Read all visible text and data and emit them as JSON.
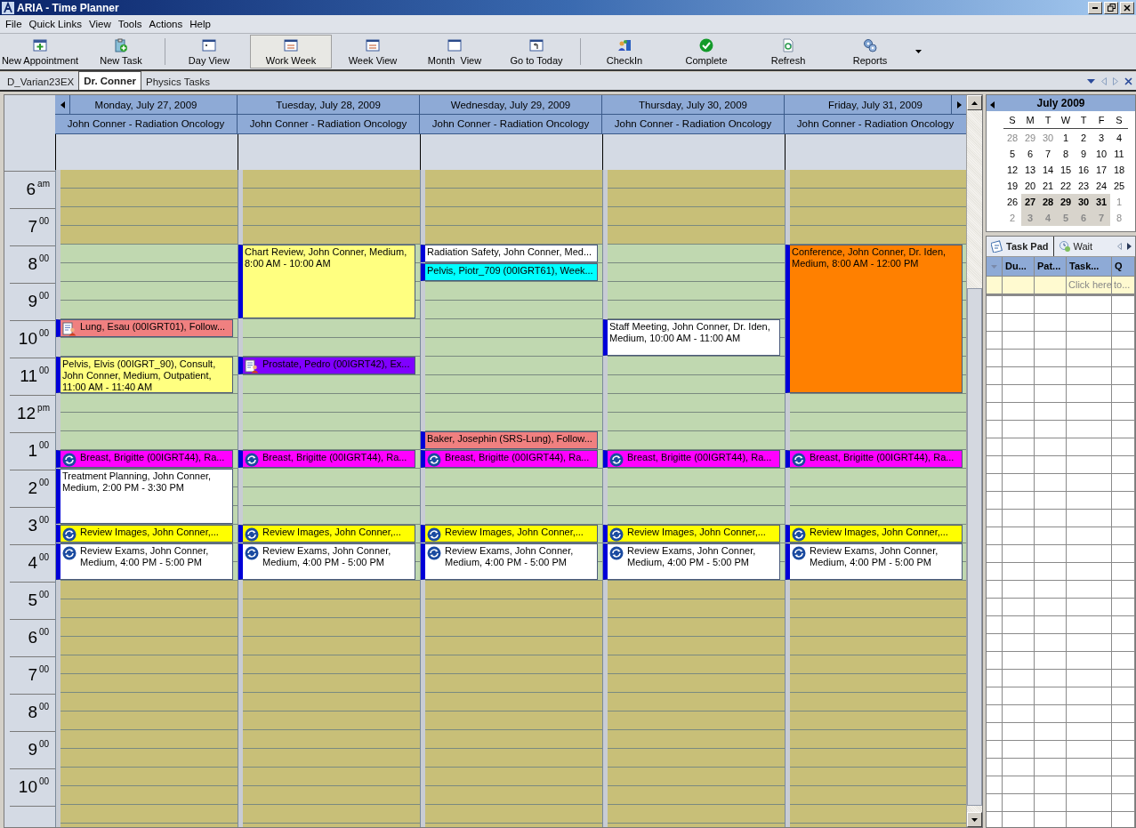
{
  "window": {
    "title": "ARIA - Time Planner"
  },
  "menu": [
    "File",
    "Quick Links",
    "View",
    "Tools",
    "Actions",
    "Help"
  ],
  "toolbar": {
    "groups": [
      [
        {
          "label": "New Appointment",
          "kind": "new-appointment",
          "selected": false
        },
        {
          "label": "New Task",
          "kind": "new-task",
          "selected": false
        }
      ],
      [
        {
          "label": "Day View",
          "kind": "day",
          "selected": false
        },
        {
          "label": "Work Week",
          "kind": "work-week",
          "selected": true
        },
        {
          "label": "Week View",
          "kind": "week",
          "selected": false
        },
        {
          "label": "Month  View",
          "kind": "month",
          "selected": false
        },
        {
          "label": "Go to Today",
          "kind": "today",
          "selected": false
        }
      ],
      [
        {
          "label": "CheckIn",
          "kind": "checkin",
          "selected": false
        },
        {
          "label": "Complete",
          "kind": "complete",
          "selected": false
        },
        {
          "label": "Refresh",
          "kind": "refresh",
          "selected": false
        },
        {
          "label": "Reports",
          "kind": "reports",
          "selected": false
        }
      ]
    ]
  },
  "tabs": [
    {
      "label": "D_Varian23EX",
      "selected": false
    },
    {
      "label": "Dr. Conner",
      "selected": true
    },
    {
      "label": "Physics Tasks",
      "selected": false
    }
  ],
  "schedule": {
    "hours": [
      {
        "hour": "6",
        "suffix": "am",
        "working": false
      },
      {
        "hour": "7",
        "suffix": "00",
        "working": false
      },
      {
        "hour": "8",
        "suffix": "00",
        "working": true
      },
      {
        "hour": "9",
        "suffix": "00",
        "working": true
      },
      {
        "hour": "10",
        "suffix": "00",
        "working": true
      },
      {
        "hour": "11",
        "suffix": "00",
        "working": true
      },
      {
        "hour": "12",
        "suffix": "pm",
        "working": true
      },
      {
        "hour": "1",
        "suffix": "00",
        "working": true
      },
      {
        "hour": "2",
        "suffix": "00",
        "working": true
      },
      {
        "hour": "3",
        "suffix": "00",
        "working": true
      },
      {
        "hour": "4",
        "suffix": "00",
        "working": true
      },
      {
        "hour": "5",
        "suffix": "00",
        "working": false
      },
      {
        "hour": "6",
        "suffix": "00",
        "working": false
      },
      {
        "hour": "7",
        "suffix": "00",
        "working": false
      },
      {
        "hour": "8",
        "suffix": "00",
        "working": false
      },
      {
        "hour": "9",
        "suffix": "00",
        "working": false
      },
      {
        "hour": "10",
        "suffix": "00",
        "working": false
      }
    ],
    "days": [
      {
        "date": "Monday, July 27, 2009",
        "resource": "John Conner - Radiation Oncology",
        "slots": [
          {
            "kind": "free"
          },
          {
            "kind": "free"
          },
          {
            "kind": "free"
          },
          {
            "kind": "free"
          },
          {
            "kind": "free"
          },
          {
            "kind": "free"
          },
          {
            "kind": "free"
          },
          {
            "kind": "free"
          },
          {
            "kind": "patient-appointment",
            "text": "Lung, Esau (00IGRT01), Follow...",
            "color": "#f08080"
          },
          {
            "kind": "free"
          },
          {
            "kind": "appointment",
            "text": "Pelvis, Elvis (00IGRT_90), Consult, John Conner, Medium, Outpatient, 11:00 AM - 11:40 AM",
            "color": "#ffff80"
          },
          {
            "kind": "continued"
          },
          {
            "kind": "free"
          },
          {
            "kind": "free"
          },
          {
            "kind": "free"
          },
          {
            "kind": "recurring-appointment",
            "text": "Breast, Brigitte (00IGRT44), Ra...",
            "color": "#ff00ff"
          },
          {
            "kind": "appointment",
            "text": "Treatment Planning, John Conner, Medium, 2:00 PM - 3:30 PM",
            "color": "#ffffff"
          },
          {
            "kind": "continued"
          },
          {
            "kind": "continued"
          },
          {
            "kind": "recurring-appointment",
            "text": "Review Images, John Conner,...",
            "color": "#ffff00"
          },
          {
            "kind": "recurring-appointment",
            "text": "Review Exams, John Conner, Medium, 4:00 PM - 5:00 PM",
            "color": "#ffffff"
          },
          {
            "kind": "continued"
          }
        ]
      },
      {
        "date": "Tuesday, July 28, 2009",
        "resource": "John Conner - Radiation Oncology",
        "slots": [
          {
            "kind": "free"
          },
          {
            "kind": "free"
          },
          {
            "kind": "free"
          },
          {
            "kind": "free"
          },
          {
            "kind": "appointment",
            "text": "Chart Review, John Conner, Medium, 8:00 AM - 10:00 AM",
            "color": "#ffff80"
          },
          {
            "kind": "continued"
          },
          {
            "kind": "continued"
          },
          {
            "kind": "continued"
          },
          {
            "kind": "free"
          },
          {
            "kind": "free"
          },
          {
            "kind": "patient-appointment",
            "text": "Prostate, Pedro (00IGRT42), Ex...",
            "color": "#8000ff"
          },
          {
            "kind": "free"
          },
          {
            "kind": "free"
          },
          {
            "kind": "free"
          },
          {
            "kind": "free"
          },
          {
            "kind": "recurring-appointment",
            "text": "Breast, Brigitte (00IGRT44), Ra...",
            "color": "#ff00ff"
          },
          {
            "kind": "free"
          },
          {
            "kind": "free"
          },
          {
            "kind": "free"
          },
          {
            "kind": "recurring-appointment",
            "text": "Review Images, John Conner,...",
            "color": "#ffff00"
          },
          {
            "kind": "recurring-appointment",
            "text": "Review Exams, John Conner, Medium, 4:00 PM - 5:00 PM",
            "color": "#ffffff"
          },
          {
            "kind": "continued"
          }
        ]
      },
      {
        "date": "Wednesday, July 29, 2009",
        "resource": "John Conner - Radiation Oncology",
        "slots": [
          {
            "kind": "free"
          },
          {
            "kind": "free"
          },
          {
            "kind": "free"
          },
          {
            "kind": "free"
          },
          {
            "kind": "appointment",
            "text": "Radiation Safety, John Conner, Med...",
            "color": "#ffffff"
          },
          {
            "kind": "appointment",
            "text": "Pelvis, Piotr_709 (00IGRT61), Week...",
            "color": "#00ffff"
          },
          {
            "kind": "free"
          },
          {
            "kind": "free"
          },
          {
            "kind": "free"
          },
          {
            "kind": "free"
          },
          {
            "kind": "free"
          },
          {
            "kind": "free"
          },
          {
            "kind": "free"
          },
          {
            "kind": "free"
          },
          {
            "kind": "appointment",
            "text": "Baker, Josephin (SRS-Lung), Follow...",
            "color": "#f08080"
          },
          {
            "kind": "recurring-appointment",
            "text": "Breast, Brigitte (00IGRT44), Ra...",
            "color": "#ff00ff"
          },
          {
            "kind": "free"
          },
          {
            "kind": "free"
          },
          {
            "kind": "free"
          },
          {
            "kind": "recurring-appointment",
            "text": "Review Images, John Conner,...",
            "color": "#ffff00"
          },
          {
            "kind": "recurring-appointment",
            "text": "Review Exams, John Conner, Medium, 4:00 PM - 5:00 PM",
            "color": "#ffffff"
          },
          {
            "kind": "continued"
          }
        ]
      },
      {
        "date": "Thursday, July 30, 2009",
        "resource": "John Conner - Radiation Oncology",
        "slots": [
          {
            "kind": "free"
          },
          {
            "kind": "free"
          },
          {
            "kind": "free"
          },
          {
            "kind": "free"
          },
          {
            "kind": "free"
          },
          {
            "kind": "free"
          },
          {
            "kind": "free"
          },
          {
            "kind": "free"
          },
          {
            "kind": "appointment",
            "text": "Staff Meeting, John Conner, Dr. Iden, Medium, 10:00 AM - 11:00 AM",
            "color": "#ffffff"
          },
          {
            "kind": "continued"
          },
          {
            "kind": "free"
          },
          {
            "kind": "free"
          },
          {
            "kind": "free"
          },
          {
            "kind": "free"
          },
          {
            "kind": "free"
          },
          {
            "kind": "recurring-appointment",
            "text": "Breast, Brigitte (00IGRT44), Ra...",
            "color": "#ff00ff"
          },
          {
            "kind": "free"
          },
          {
            "kind": "free"
          },
          {
            "kind": "free"
          },
          {
            "kind": "recurring-appointment",
            "text": "Review Images, John Conner,...",
            "color": "#ffff00"
          },
          {
            "kind": "recurring-appointment",
            "text": "Review Exams, John Conner, Medium, 4:00 PM - 5:00 PM",
            "color": "#ffffff"
          },
          {
            "kind": "continued"
          }
        ]
      },
      {
        "date": "Friday, July 31, 2009",
        "resource": "John Conner - Radiation Oncology",
        "slots": [
          {
            "kind": "free"
          },
          {
            "kind": "free"
          },
          {
            "kind": "free"
          },
          {
            "kind": "free"
          },
          {
            "kind": "appointment",
            "text": "Conference, John Conner, Dr. Iden, Medium, 8:00 AM - 12:00 PM",
            "color": "#ff8000"
          },
          {
            "kind": "continued"
          },
          {
            "kind": "continued"
          },
          {
            "kind": "continued"
          },
          {
            "kind": "continued"
          },
          {
            "kind": "continued"
          },
          {
            "kind": "continued"
          },
          {
            "kind": "continued"
          },
          {
            "kind": "free"
          },
          {
            "kind": "free"
          },
          {
            "kind": "free"
          },
          {
            "kind": "recurring-appointment",
            "text": "Breast, Brigitte (00IGRT44), Ra...",
            "color": "#ff00ff"
          },
          {
            "kind": "free"
          },
          {
            "kind": "free"
          },
          {
            "kind": "free"
          },
          {
            "kind": "recurring-appointment",
            "text": "Review Images, John Conner,...",
            "color": "#ffff00"
          },
          {
            "kind": "recurring-appointment",
            "text": "Review Exams, John Conner, Medium, 4:00 PM - 5:00 PM",
            "color": "#ffffff"
          },
          {
            "kind": "continued"
          }
        ]
      }
    ]
  },
  "mini_calendar": {
    "month": "July 2009",
    "weekdays": [
      "S",
      "M",
      "T",
      "W",
      "T",
      "F",
      "S"
    ],
    "weeks": [
      [
        {
          "label": "28",
          "other_month": true,
          "selected": false
        },
        {
          "label": "29",
          "other_month": true,
          "selected": false
        },
        {
          "label": "30",
          "other_month": true,
          "selected": false
        },
        {
          "label": "1",
          "other_month": false,
          "selected": false
        },
        {
          "label": "2",
          "other_month": false,
          "selected": false
        },
        {
          "label": "3",
          "other_month": false,
          "selected": false
        },
        {
          "label": "4",
          "other_month": false,
          "selected": false
        }
      ],
      [
        {
          "label": "5",
          "other_month": false,
          "selected": false
        },
        {
          "label": "6",
          "other_month": false,
          "selected": false
        },
        {
          "label": "7",
          "other_month": false,
          "selected": false
        },
        {
          "label": "8",
          "other_month": false,
          "selected": false
        },
        {
          "label": "9",
          "other_month": false,
          "selected": false
        },
        {
          "label": "10",
          "other_month": false,
          "selected": false
        },
        {
          "label": "11",
          "other_month": false,
          "selected": false
        }
      ],
      [
        {
          "label": "12",
          "other_month": false,
          "selected": false
        },
        {
          "label": "13",
          "other_month": false,
          "selected": false
        },
        {
          "label": "14",
          "other_month": false,
          "selected": false
        },
        {
          "label": "15",
          "other_month": false,
          "selected": false
        },
        {
          "label": "16",
          "other_month": false,
          "selected": false
        },
        {
          "label": "17",
          "other_month": false,
          "selected": false
        },
        {
          "label": "18",
          "other_month": false,
          "selected": false
        }
      ],
      [
        {
          "label": "19",
          "other_month": false,
          "selected": false
        },
        {
          "label": "20",
          "other_month": false,
          "selected": false
        },
        {
          "label": "21",
          "other_month": false,
          "selected": false
        },
        {
          "label": "22",
          "other_month": false,
          "selected": false
        },
        {
          "label": "23",
          "other_month": false,
          "selected": false
        },
        {
          "label": "24",
          "other_month": false,
          "selected": false
        },
        {
          "label": "25",
          "other_month": false,
          "selected": false
        }
      ],
      [
        {
          "label": "26",
          "other_month": false,
          "selected": false
        },
        {
          "label": "27",
          "other_month": false,
          "selected": true
        },
        {
          "label": "28",
          "other_month": false,
          "selected": true
        },
        {
          "label": "29",
          "other_month": false,
          "selected": true
        },
        {
          "label": "30",
          "other_month": false,
          "selected": true
        },
        {
          "label": "31",
          "other_month": false,
          "selected": true
        },
        {
          "label": "1",
          "other_month": true,
          "selected": false
        }
      ],
      [
        {
          "label": "2",
          "other_month": true,
          "selected": false
        },
        {
          "label": "3",
          "other_month": true,
          "selected": true
        },
        {
          "label": "4",
          "other_month": true,
          "selected": true
        },
        {
          "label": "5",
          "other_month": true,
          "selected": true
        },
        {
          "label": "6",
          "other_month": true,
          "selected": true
        },
        {
          "label": "7",
          "other_month": true,
          "selected": true
        },
        {
          "label": "8",
          "other_month": true,
          "selected": false
        }
      ]
    ]
  },
  "task_pad": {
    "tabs": [
      {
        "label": "Task Pad",
        "selected": true
      },
      {
        "label": "Wait",
        "selected": false
      }
    ],
    "columns": [
      "Du...",
      "Pat...",
      "Task...",
      "Q"
    ],
    "new_row": [
      "Click here",
      "to..."
    ]
  }
}
